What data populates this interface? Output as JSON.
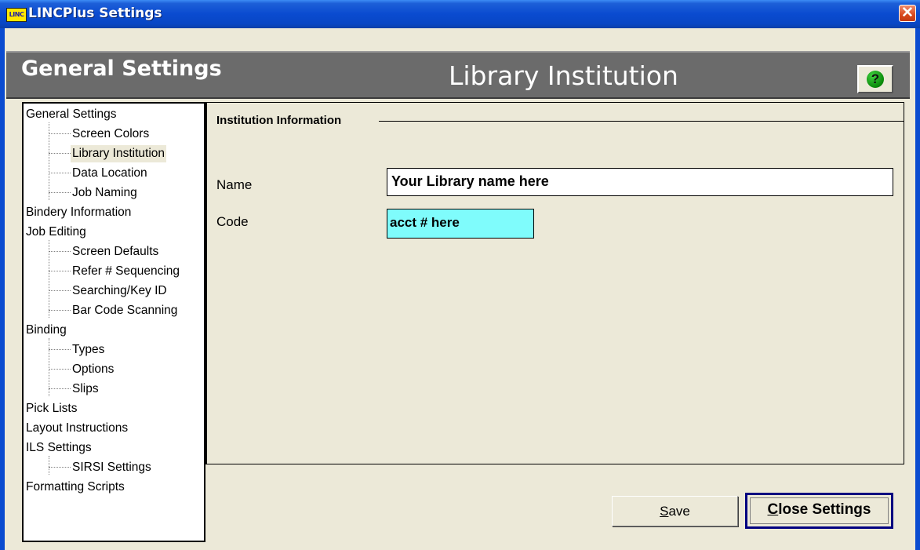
{
  "window": {
    "title": "LINCPlus Settings",
    "app_icon_text": "LINC",
    "close_glyph": "✕",
    "colors": {
      "titlebar": "#0a4bd0",
      "header": "#6b6b6b",
      "code_field": "#7ffcfc",
      "default_button_border": "#000080"
    }
  },
  "header": {
    "section": "General Settings",
    "page": "Library Institution",
    "help_glyph": "?"
  },
  "tree": {
    "items": [
      {
        "label": "General Settings",
        "level": 0
      },
      {
        "label": "Screen Colors",
        "level": 1
      },
      {
        "label": "Library Institution",
        "level": 1,
        "selected": true
      },
      {
        "label": "Data Location",
        "level": 1
      },
      {
        "label": "Job Naming",
        "level": 1
      },
      {
        "label": "Bindery Information",
        "level": 0
      },
      {
        "label": "Job Editing",
        "level": 0
      },
      {
        "label": "Screen Defaults",
        "level": 1
      },
      {
        "label": "Refer # Sequencing",
        "level": 1
      },
      {
        "label": "Searching/Key ID",
        "level": 1
      },
      {
        "label": "Bar Code Scanning",
        "level": 1
      },
      {
        "label": "Binding",
        "level": 0
      },
      {
        "label": "Types",
        "level": 1
      },
      {
        "label": "Options",
        "level": 1
      },
      {
        "label": "Slips",
        "level": 1
      },
      {
        "label": "Pick Lists",
        "level": 0
      },
      {
        "label": "Layout Instructions",
        "level": 0
      },
      {
        "label": "ILS Settings",
        "level": 0
      },
      {
        "label": "SIRSI Settings",
        "level": 1
      },
      {
        "label": "Formatting Scripts",
        "level": 0
      }
    ]
  },
  "form": {
    "group_title": "Institution Information",
    "name_label": "Name",
    "name_value": "Your Library name here",
    "code_label": "Code",
    "code_value": "acct # here"
  },
  "buttons": {
    "save_first": "S",
    "save_rest": "ave",
    "close_first": "C",
    "close_rest": "lose Settings"
  }
}
